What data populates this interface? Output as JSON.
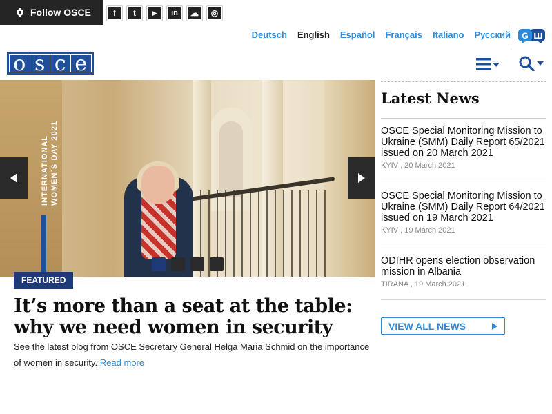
{
  "topbar": {
    "follow_label": "Follow OSCE",
    "social": [
      {
        "icon": "facebook-icon",
        "glyph": "f"
      },
      {
        "icon": "twitter-icon",
        "glyph": "t"
      },
      {
        "icon": "youtube-icon",
        "glyph": "▶"
      },
      {
        "icon": "linkedin-icon",
        "glyph": "in"
      },
      {
        "icon": "soundcloud-icon",
        "glyph": "☁"
      },
      {
        "icon": "instagram-icon",
        "glyph": "◎"
      }
    ]
  },
  "languages": [
    {
      "label": "Deutsch",
      "active": false
    },
    {
      "label": "English",
      "active": true
    },
    {
      "label": "Español",
      "active": false
    },
    {
      "label": "Français",
      "active": false
    },
    {
      "label": "Italiano",
      "active": false
    },
    {
      "label": "Русский",
      "active": false
    }
  ],
  "header": {
    "logo_letters": [
      "o",
      "s",
      "c",
      "e"
    ],
    "brand_color": "#1f4e9a"
  },
  "hero": {
    "vertical_text_line1": "INTERNATIONAL",
    "vertical_text_line2": "WOMEN´S DAY 2021",
    "featured_label": "FEATURED",
    "headline": "It’s more than a seat at the table: why we need women in security",
    "summary": "See the latest blog from OSCE Secretary General Helga Maria Schmid on the importance of women in security.",
    "read_more": "Read more",
    "slides": 4,
    "active_slide": 0
  },
  "news": {
    "heading": "Latest News",
    "items": [
      {
        "title": "OSCE Special Monitoring Mission to Ukraine (SMM) Daily Report 65/2021 issued on 20 March 2021",
        "meta": "KYIV , 20 March 2021"
      },
      {
        "title": "OSCE Special Monitoring Mission to Ukraine (SMM) Daily Report 64/2021 issued on 19 March 2021",
        "meta": "KYIV , 19 March 2021"
      },
      {
        "title": "ODIHR opens election observation mission in Albania",
        "meta": "TIRANA , 19 March 2021"
      }
    ],
    "view_all": "VIEW ALL NEWS"
  },
  "colors": {
    "accent": "#2e8ad8",
    "featured_bg": "#1f3a78",
    "dark": "#252525"
  }
}
